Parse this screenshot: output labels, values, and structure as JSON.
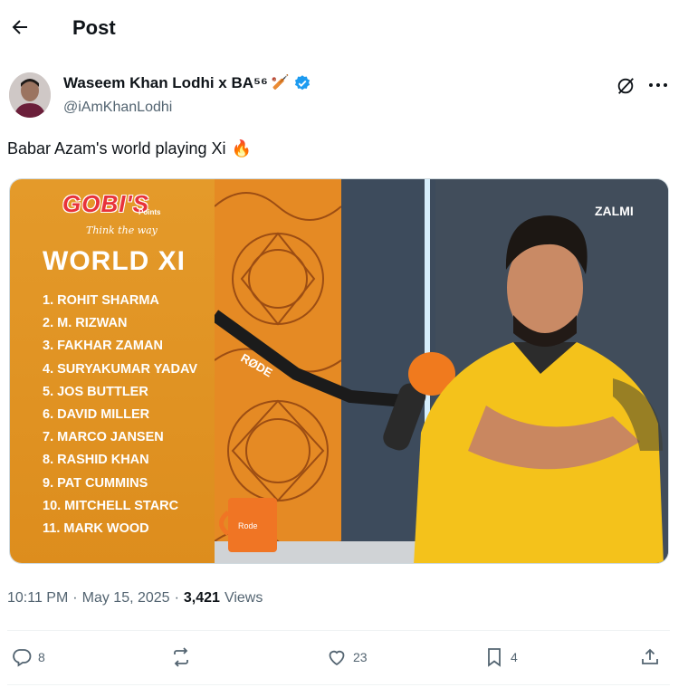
{
  "header": {
    "title": "Post",
    "back_icon": "arrow-left-icon"
  },
  "author": {
    "display_name": "Waseem Khan Lodhi x BA⁵⁶",
    "badge_emoji": "🏏",
    "verified_color": "#1d9bf0",
    "handle": "@iAmKhanLodhi"
  },
  "tweet": {
    "text": "Babar Azam's world playing Xi",
    "emoji": "🔥"
  },
  "media": {
    "logo_text": "GOBI'S",
    "logo_sub": "Points",
    "logo_tag": "Think the way",
    "title": "WORLD XI",
    "players": [
      "1. ROHIT SHARMA",
      "2. M. RIZWAN",
      "3. FAKHAR ZAMAN",
      "4. SURYAKUMAR YADAV",
      "5. JOS BUTTLER",
      "6. DAVID MILLER",
      "7. MARCO JANSEN",
      "8. RASHID KHAN",
      "9. PAT CUMMINS",
      "10. MITCHELL STARC",
      "11. MARK WOOD"
    ],
    "mic_brand": "RØDE",
    "overlay_logo": "ZALMI",
    "panel_color": "#e0911f"
  },
  "meta": {
    "time": "10:11 PM",
    "sep1": "·",
    "date": "May 15, 2025",
    "sep2": "·",
    "views_count": "3,421",
    "views_label": "Views"
  },
  "actions": {
    "replies": "8",
    "reposts": "",
    "likes": "23",
    "bookmarks": "4"
  }
}
